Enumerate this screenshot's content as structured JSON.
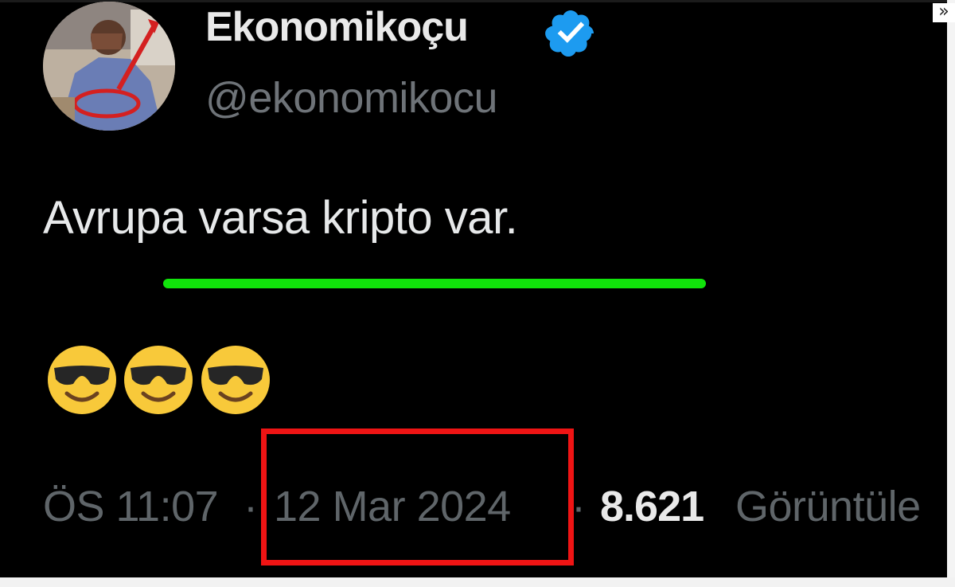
{
  "tweet": {
    "display_name": "Ekonomikoçu",
    "handle": "@ekonomikocu",
    "text": "Avrupa varsa kripto var.",
    "emojis": [
      "smiling-face-with-sunglasses",
      "smiling-face-with-sunglasses",
      "smiling-face-with-sunglasses"
    ],
    "time": "ÖS 11:07",
    "separator": "·",
    "date": "12 Mar 2024",
    "views_count": "8.621",
    "views_label": "Görüntüle"
  },
  "colors": {
    "background": "#000000",
    "highlight_underline": "#11e40b",
    "highlight_box": "#ef1414",
    "verified_badge": "#1d9bf0"
  },
  "ui": {
    "skip_icon": "double-chevron-right-icon",
    "skip_glyph": "»"
  }
}
